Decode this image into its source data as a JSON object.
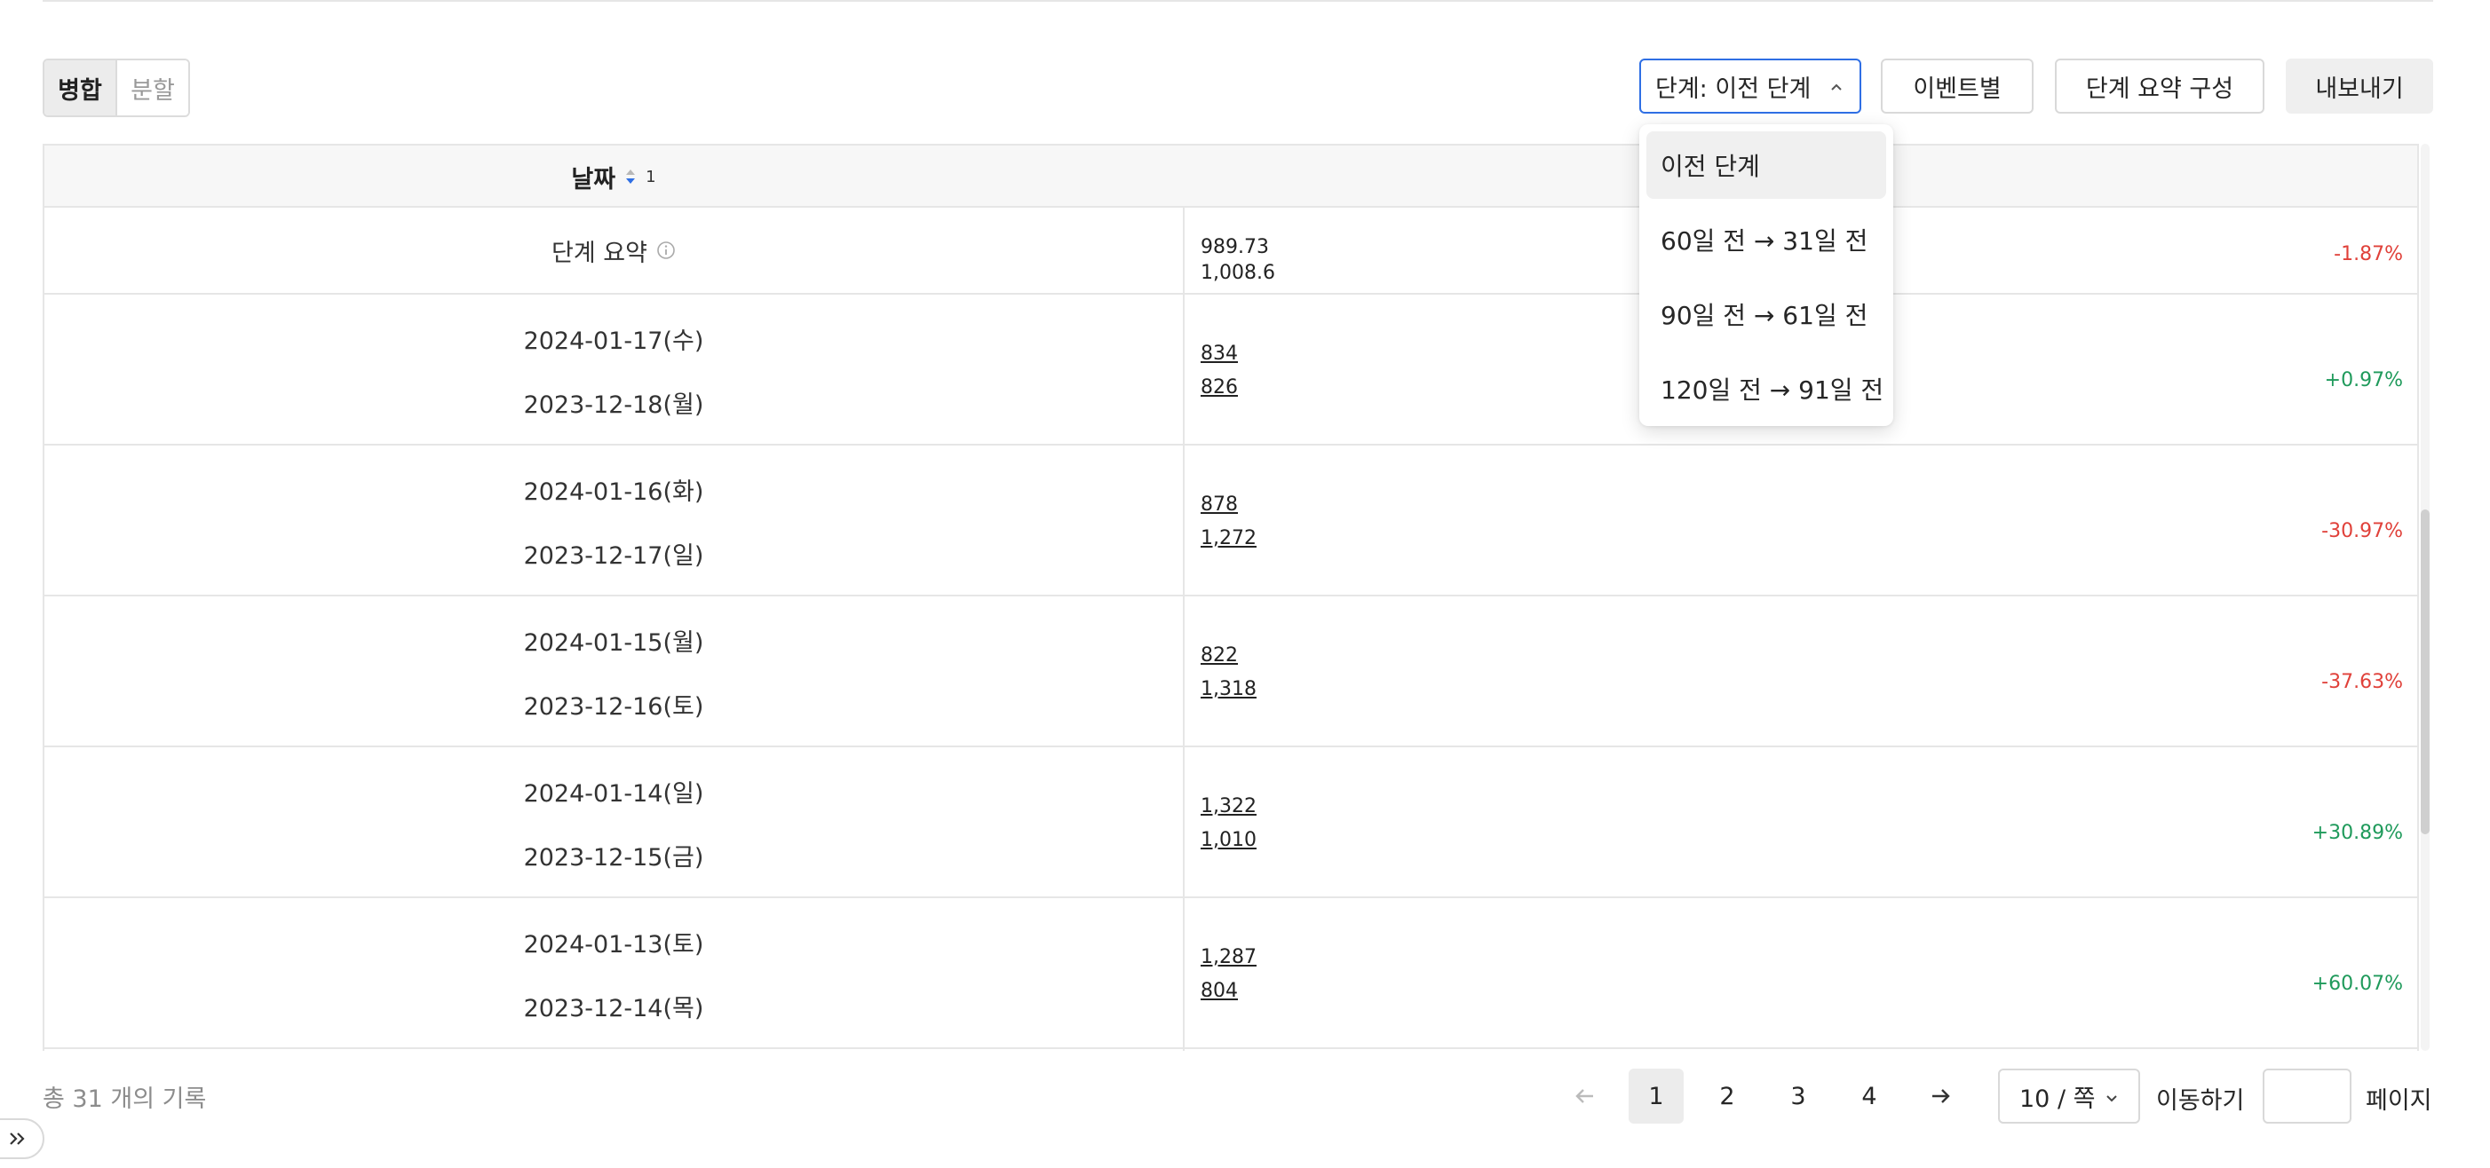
{
  "view_toggle": {
    "merge_label": "병합",
    "split_label": "분할"
  },
  "toolbar": {
    "stage_select_label": "단계: 이전 단계",
    "by_event_label": "이벤트별",
    "summary_config_label": "단계 요약 구성",
    "export_label": "내보내기"
  },
  "dropdown": {
    "options": [
      "이전 단계",
      "60일 전 → 31일 전",
      "90일 전 → 61일 전",
      "120일 전 → 91일 전"
    ]
  },
  "table": {
    "date_header": "날짜",
    "sort_order": "1",
    "summary": {
      "label": "단계 요약",
      "current": "989.73",
      "previous": "1,008.6",
      "change": "-1.87%"
    },
    "rows": [
      {
        "date": "2024-01-17(수)",
        "compare_date": "2023-12-18(월)",
        "current": "834",
        "previous": "826",
        "change": "+0.97%"
      },
      {
        "date": "2024-01-16(화)",
        "compare_date": "2023-12-17(일)",
        "current": "878",
        "previous": "1,272",
        "change": "-30.97%"
      },
      {
        "date": "2024-01-15(월)",
        "compare_date": "2023-12-16(토)",
        "current": "822",
        "previous": "1,318",
        "change": "-37.63%"
      },
      {
        "date": "2024-01-14(일)",
        "compare_date": "2023-12-15(금)",
        "current": "1,322",
        "previous": "1,010",
        "change": "+30.89%"
      },
      {
        "date": "2024-01-13(토)",
        "compare_date": "2023-12-14(목)",
        "current": "1,287",
        "previous": "804",
        "change": "+60.07%"
      }
    ]
  },
  "pagination": {
    "total_text": "총 31 개의 기록",
    "pages": [
      "1",
      "2",
      "3",
      "4"
    ],
    "current_page": "1",
    "page_size": "10 / 쪽",
    "goto_label": "이동하기",
    "goto_suffix": "페이지",
    "goto_value": ""
  },
  "colors": {
    "accent": "#2f6fe4",
    "negative": "#e0413a",
    "positive": "#1f9a5b"
  },
  "icons": {
    "sort": "sort-icon",
    "info": "info-icon",
    "chevron_up": "chevron-up-icon",
    "chevron_down": "chevron-down-icon",
    "prev": "arrow-left-icon",
    "next": "arrow-right-icon",
    "expand": "double-chevron-right-icon"
  }
}
